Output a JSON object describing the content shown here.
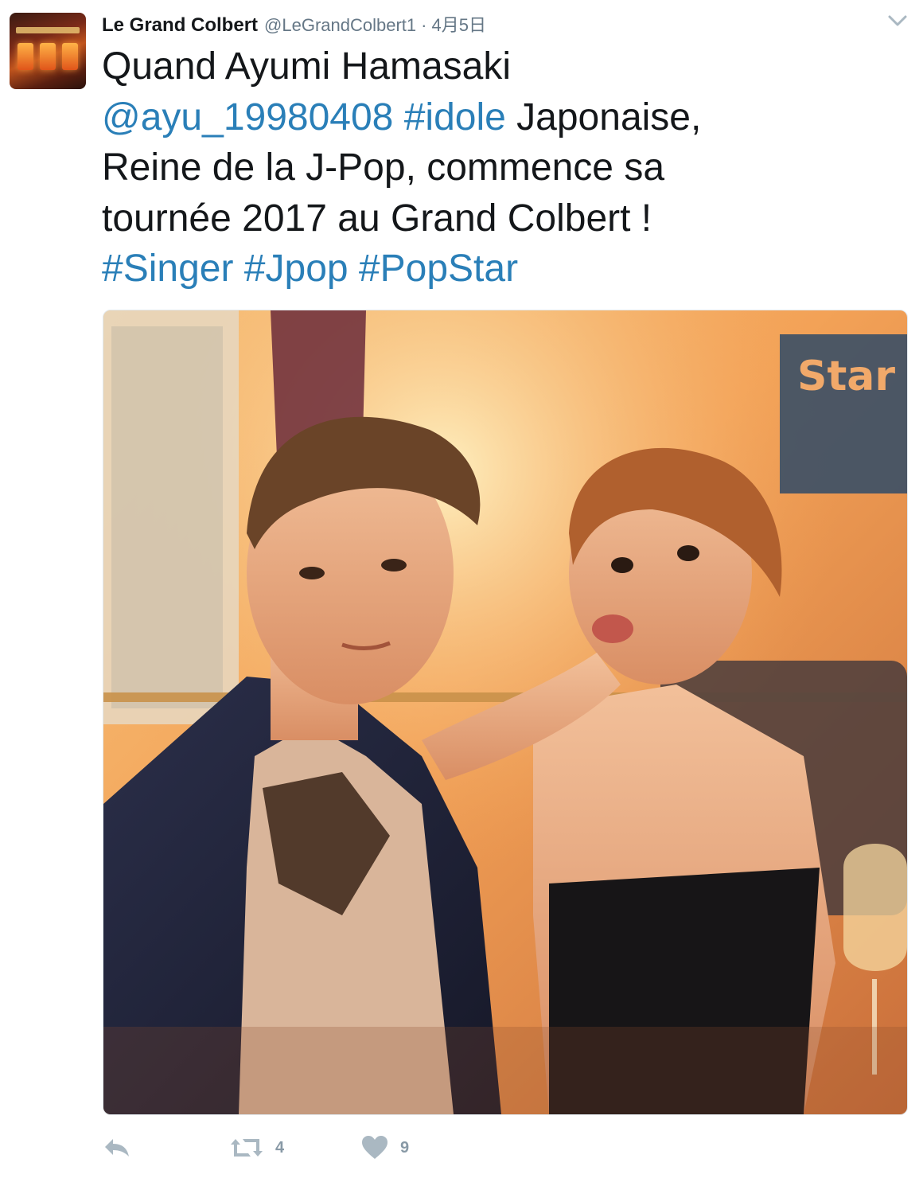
{
  "tweet": {
    "display_name": "Le Grand Colbert",
    "handle": "@LeGrandColbert1",
    "separator": "·",
    "date": "4月5日",
    "text_line1": "Quand Ayumi Hamasaki",
    "mention": "@ayu_19980408",
    "hashtag_idole": "#idole",
    "text_line2_rest": " Japonaise,",
    "text_line3": "Reine de la J-Pop, commence sa",
    "text_line4": "tournée 2017 au Grand Colbert !",
    "hashtags_line": [
      "#Singer",
      "#Jpop",
      "#PopStar"
    ]
  },
  "media": {
    "sign_text": "Star"
  },
  "actions": {
    "retweet_count": "4",
    "like_count": "9"
  },
  "colors": {
    "link": "#2a7fb8",
    "icon_gray": "#aab8c2",
    "text": "#14171a",
    "secondary": "#657786"
  },
  "icons": [
    "reply-icon",
    "retweet-icon",
    "heart-icon",
    "chevron-down-icon"
  ]
}
